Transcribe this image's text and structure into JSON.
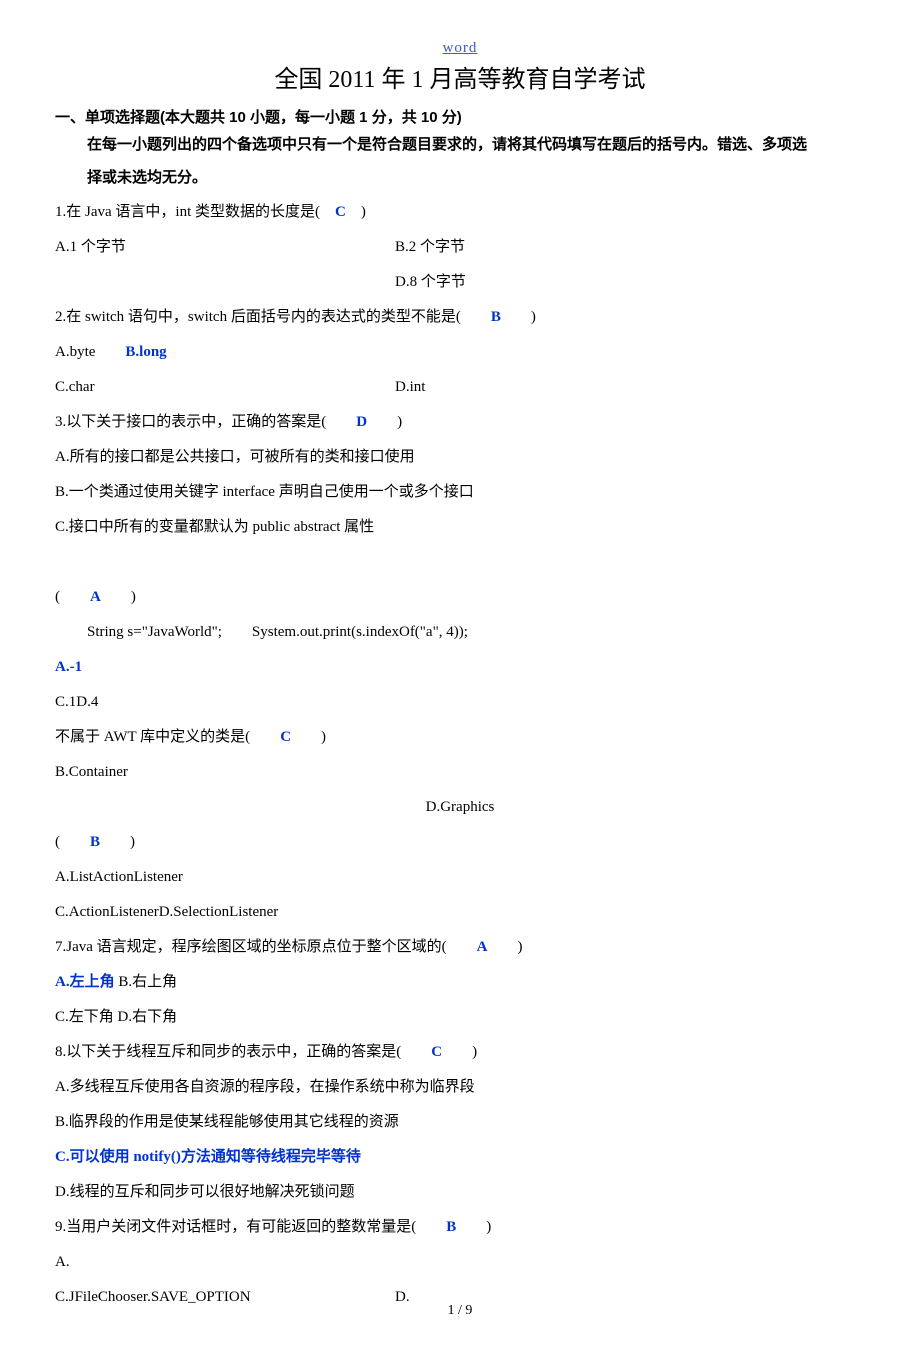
{
  "header_label": "word",
  "title": "全国 2011 年 1 月高等教育自学考试",
  "section_heading": "一、单项选择题(本大题共 10 小题，每一小题 1 分，共 10 分)",
  "instruction_l1": "在每一小题列出的四个备选项中只有一个是符合题目要求的，请将其代码填写在题后的括号内。错选、多项选",
  "instruction_l2": "择或未选均无分。",
  "q1": {
    "stem": "1.在 Java 语言中，int 类型数据的长度是(　",
    "ans": "C",
    "after": "　)",
    "a": "A.1 个字节",
    "b": "B.2 个字节",
    "d": "D.8 个字节"
  },
  "q2": {
    "stem": "2.在 switch 语句中，switch 后面括号内的表达式的类型不能是(　　",
    "ans": "B",
    "after": "　　)",
    "a_pre": "A.byte　　",
    "b_ans": "B.long",
    "c": "C.char",
    "d": "D.int"
  },
  "q3": {
    "stem": "3.以下关于接口的表示中，正确的答案是(　　",
    "ans": "D",
    "after": "　　)",
    "a": "A.所有的接口都是公共接口，可被所有的类和接口使用",
    "b": "B.一个类通过使用关键字 interface 声明自己使用一个或多个接口",
    "c": "C.接口中所有的变量都默认为 public abstract 属性"
  },
  "q4": {
    "open": "(　　",
    "ans": "A",
    "close": "　　)",
    "code": "String s=\"JavaWorld\";　　System.out.print(s.indexOf(\"a\", 4));",
    "a_ans": "A.-1",
    "cd": "C.1D.4"
  },
  "q5": {
    "stem": "不属于 AWT 库中定义的类是(　　",
    "ans": "C",
    "after": "　　)",
    "b": "B.Container",
    "d": "D.Graphics"
  },
  "q6": {
    "open": "(　　",
    "ans": "B",
    "close": "　　)",
    "a": "A.ListActionListener",
    "cd": "C.ActionListenerD.SelectionListener"
  },
  "q7": {
    "stem": "7.Java 语言规定，程序绘图区域的坐标原点位于整个区域的(　　",
    "ans": "A",
    "after": "　　)",
    "a_ans": "A.左上角",
    "b_after": " B.右上角",
    "cd": "C.左下角 D.右下角"
  },
  "q8": {
    "stem": "8.以下关于线程互斥和同步的表示中，正确的答案是(　　",
    "ans": "C",
    "after": "　　)",
    "a": "A.多线程互斥使用各自资源的程序段，在操作系统中称为临界段",
    "b": "B.临界段的作用是使某线程能够使用其它线程的资源",
    "c_ans": "C.可以使用 notify()方法通知等待线程完毕等待",
    "d": "D.线程的互斥和同步可以很好地解决死锁问题"
  },
  "q9": {
    "stem": "9.当用户关闭文件对话框时，有可能返回的整数常量是(　　",
    "ans": "B",
    "after": "　　)",
    "a": "A.",
    "c": "C.JFileChooser.SAVE_OPTION",
    "d": "D."
  },
  "footer": "1 / 9"
}
